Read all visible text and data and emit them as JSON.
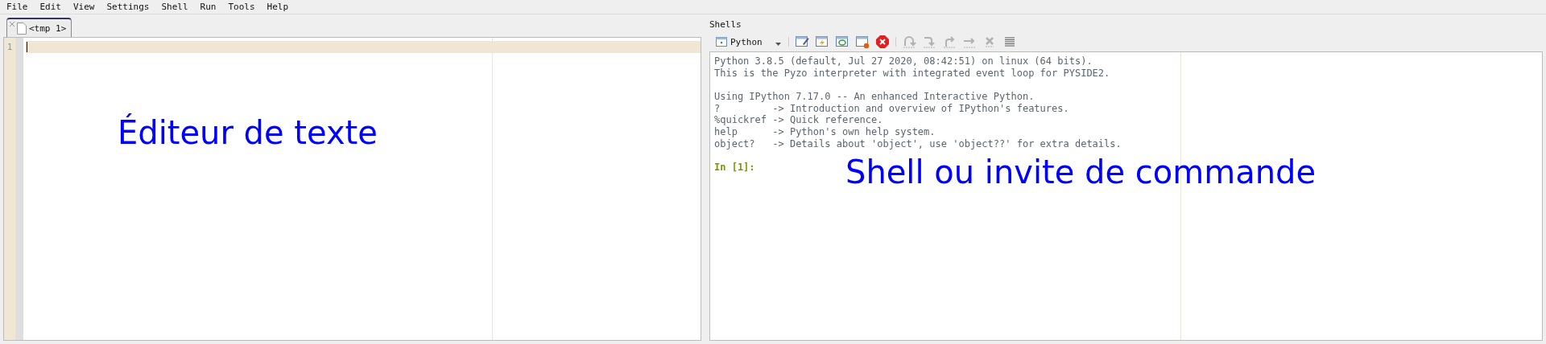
{
  "menu": [
    "File",
    "Edit",
    "View",
    "Settings",
    "Shell",
    "Run",
    "Tools",
    "Help"
  ],
  "editor": {
    "tabs": [
      {
        "label": "<tmp 1>",
        "selected": true
      }
    ],
    "line_numbers": [
      "1"
    ],
    "annotation": "Éditeur de texte"
  },
  "shells": {
    "title": "Shells",
    "kernel": "Python",
    "toolbar": [
      {
        "kind": "edit",
        "disabled": false
      },
      {
        "kind": "interrupt",
        "disabled": false
      },
      {
        "kind": "restart",
        "disabled": false
      },
      {
        "kind": "terminate",
        "disabled": false
      },
      {
        "kind": "close",
        "disabled": false
      },
      {
        "kind": "stepin",
        "disabled": true
      },
      {
        "kind": "stepover",
        "disabled": true
      },
      {
        "kind": "stepout",
        "disabled": true
      },
      {
        "kind": "continue",
        "disabled": true
      },
      {
        "kind": "stop",
        "disabled": true
      },
      {
        "kind": "list",
        "disabled": false
      }
    ],
    "output": [
      [
        "Python 3.8.5 (default, Jul 27 2020, 08:42:51) on linux (64 bits).",
        "This is the Pyzo interpreter with integrated event loop for PYSIDE2."
      ],
      [
        "Using IPython 7.17.0 -- An enhanced Interactive Python.",
        "?         -> Introduction and overview of IPython's features.",
        "%quickref -> Quick reference.",
        "help      -> Python's own help system.",
        "object?   -> Details about 'object', use 'object??' for extra details."
      ]
    ],
    "prompt": "In [1]:",
    "annotation": "Shell ou invite de commande"
  }
}
